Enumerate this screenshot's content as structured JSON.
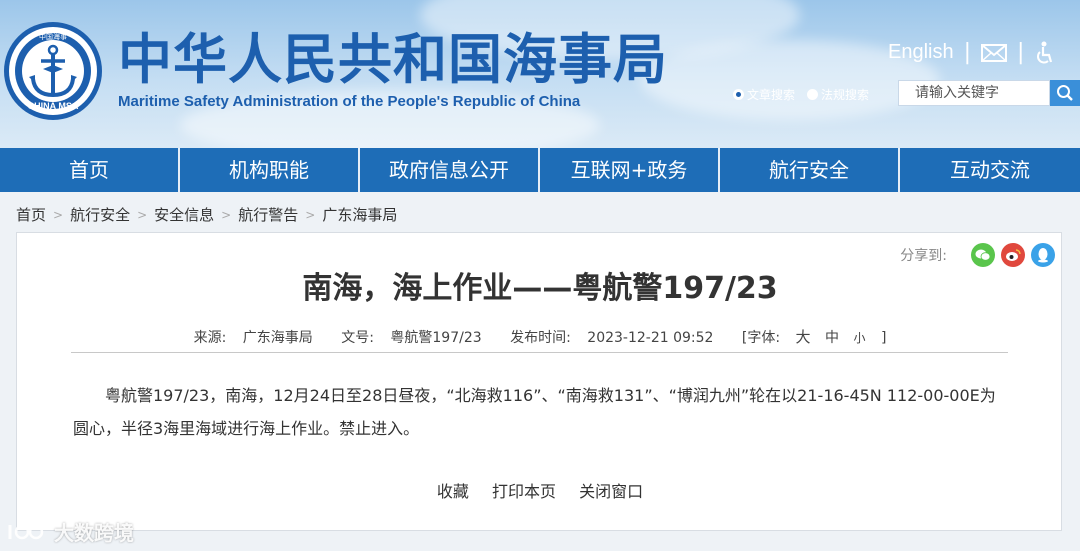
{
  "header": {
    "title_cn": "中华人民共和国海事局",
    "title_en": "Maritime Safety Administration of the People's Republic of China",
    "logo_text": "CHINA MSA",
    "logo_top_text": "中国海事",
    "english_link": "English",
    "separator": "|",
    "mail_icon": "mail-icon",
    "accessibility_icon": "accessibility-icon"
  },
  "search": {
    "options": [
      {
        "label": "文章搜索",
        "selected": true
      },
      {
        "label": "法规搜索",
        "selected": false
      }
    ],
    "placeholder": "请输入关键字",
    "button_icon": "search-icon"
  },
  "nav": {
    "items": [
      "首页",
      "机构职能",
      "政府信息公开",
      "互联网+政务",
      "航行安全",
      "互动交流"
    ]
  },
  "breadcrumb": {
    "items": [
      "首页",
      "航行安全",
      "安全信息",
      "航行警告",
      "广东海事局"
    ],
    "separator": ">"
  },
  "article": {
    "share_label": "分享到:",
    "share_icons": [
      "wechat-icon",
      "weibo-icon",
      "qq-icon"
    ],
    "title": "南海，海上作业——粤航警197/23",
    "source_label": "来源:",
    "source": "广东海事局",
    "docno_label": "文号:",
    "docno": "粤航警197/23",
    "pubtime_label": "发布时间:",
    "pubtime": "2023-12-21 09:52",
    "font_label": "[字体:",
    "font_large": "大",
    "font_medium": "中",
    "font_small": "小",
    "font_close": "]",
    "body": "粤航警197/23，南海，12月24日至28日昼夜，“北海救116”、“南海救131”、“博润九州”轮在以21-16-45N 112-00-00E为圆心，半径3海里海域进行海上作业。禁止进入。",
    "actions": [
      "收藏",
      "打印本页",
      "关闭窗口"
    ]
  },
  "watermark": {
    "text": "大数跨境"
  },
  "colors": {
    "brand_blue": "#1d5fae",
    "nav_blue": "#1e6db7",
    "wechat": "#5ac54c",
    "weibo": "#e0483d",
    "qq": "#3aa2e8"
  }
}
